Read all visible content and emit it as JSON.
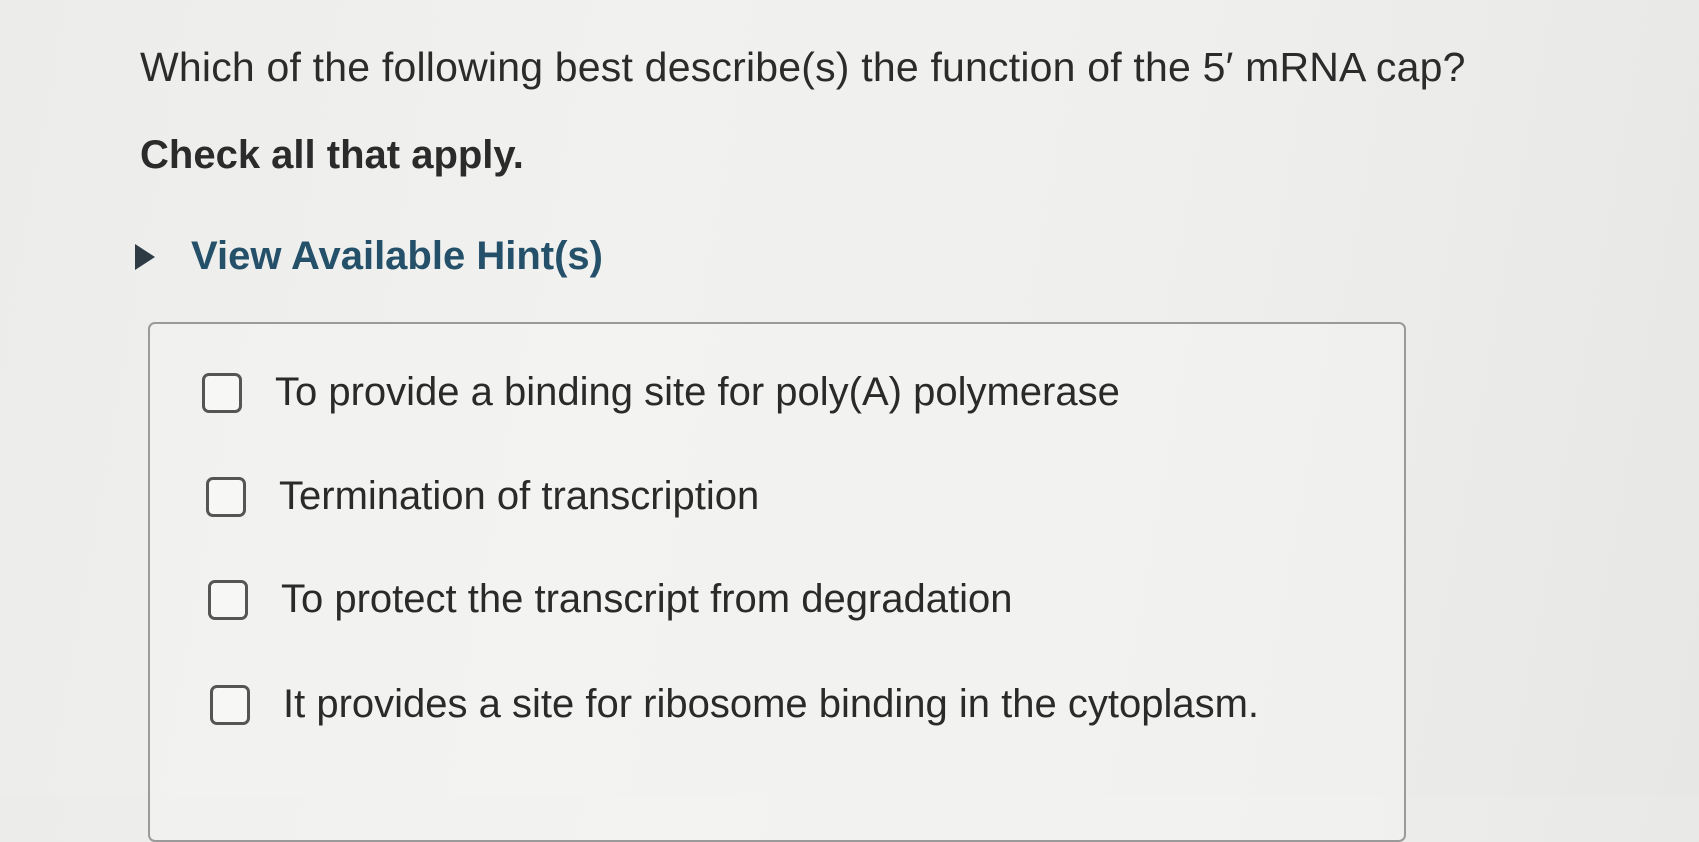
{
  "question": {
    "text": "Which of the following best describe(s) the function of the 5′ mRNA cap?",
    "instruction": "Check all that apply."
  },
  "hint": {
    "label": "View Available Hint(s)",
    "icon": "triangle-right-icon"
  },
  "options": [
    {
      "label": "To provide a binding site for poly(A) polymerase",
      "checked": false
    },
    {
      "label": "Termination of transcription",
      "checked": false
    },
    {
      "label": "To protect the transcript from degradation",
      "checked": false
    },
    {
      "label": "It provides a site for ribosome binding in the cytoplasm.",
      "checked": false
    }
  ],
  "colors": {
    "hint_text": "#24506a",
    "checkbox_border": "#555555",
    "box_border": "#9a9a9a"
  }
}
